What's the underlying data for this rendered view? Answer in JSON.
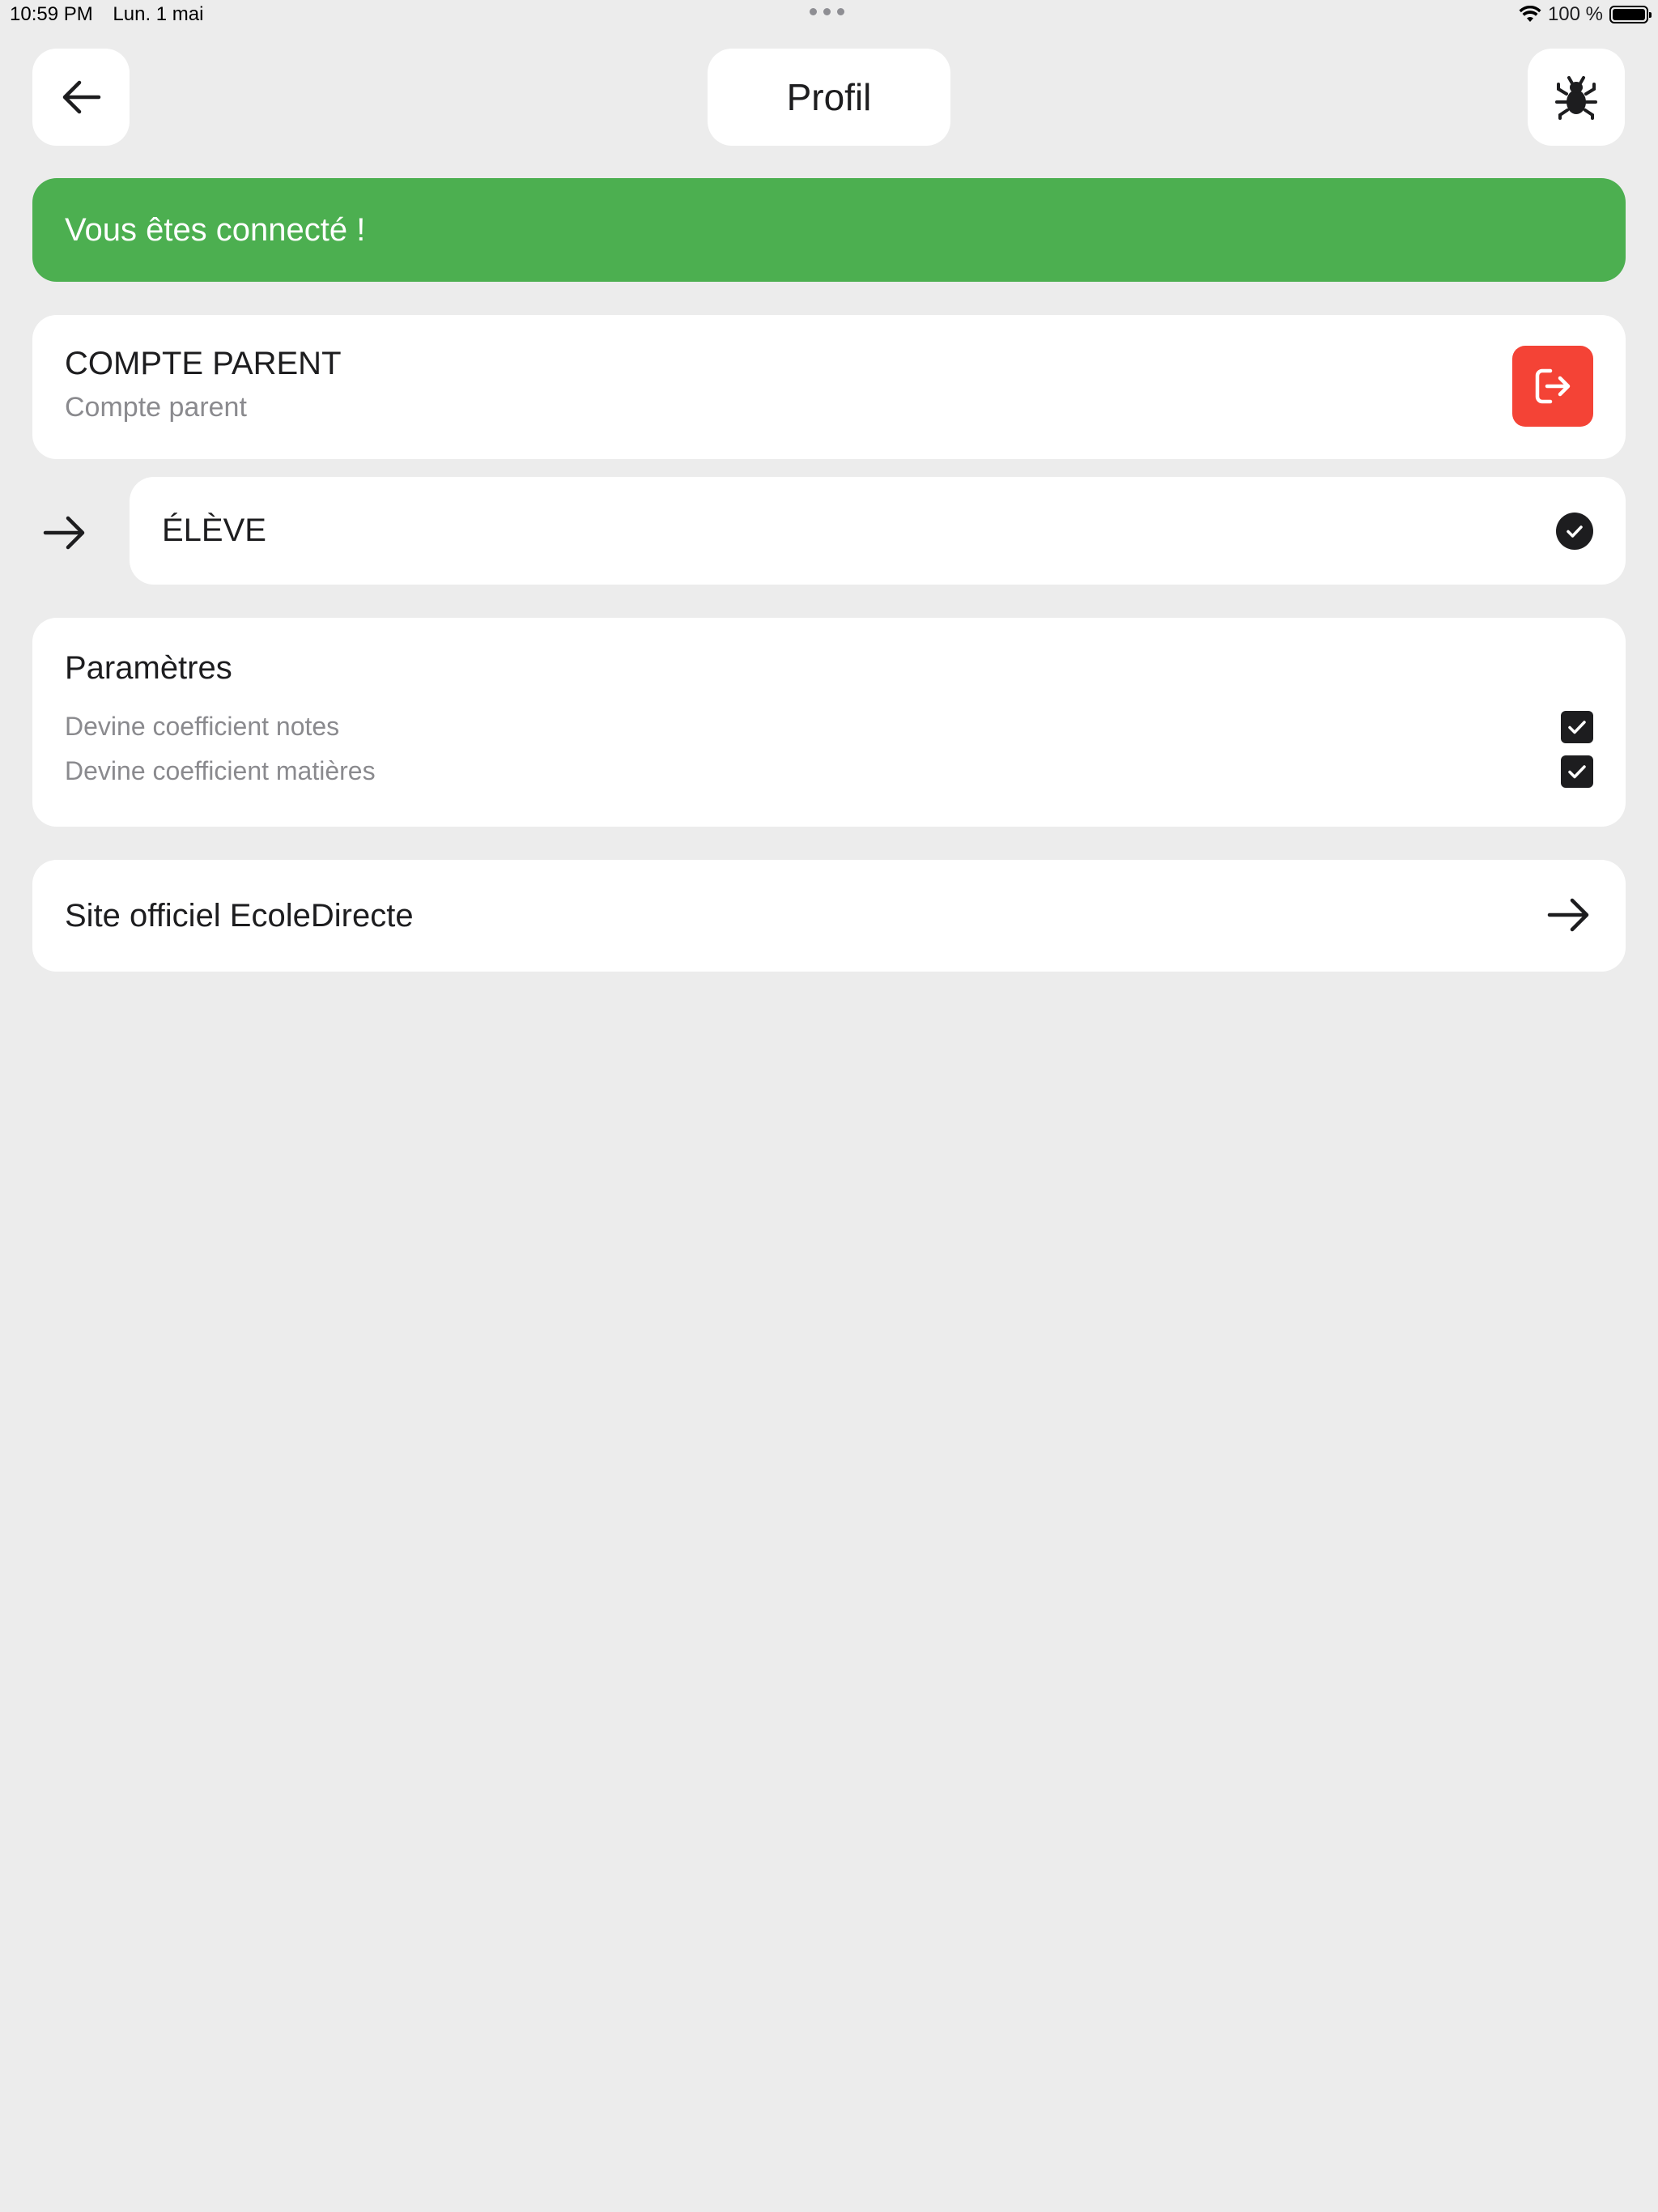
{
  "status_bar": {
    "time": "10:59 PM",
    "date": "Lun. 1 mai",
    "battery": "100 %",
    "battery_level": 1.0
  },
  "header": {
    "title": "Profil",
    "back_icon": "arrow-left-icon",
    "bug_icon": "bug-icon"
  },
  "banner": {
    "text": "Vous êtes connecté !",
    "color": "#4caf50"
  },
  "account": {
    "name": "COMPTE PARENT",
    "type": "Compte parent",
    "logout_icon": "logout-icon",
    "logout_color": "#f44336"
  },
  "student": {
    "name": "ÉLÈVE",
    "selected": true
  },
  "settings": {
    "title": "Paramètres",
    "options": [
      {
        "label": "Devine coefficient notes",
        "checked": true
      },
      {
        "label": "Devine coefficient matières",
        "checked": true
      }
    ]
  },
  "links": {
    "official_site": "Site officiel EcoleDirecte"
  }
}
